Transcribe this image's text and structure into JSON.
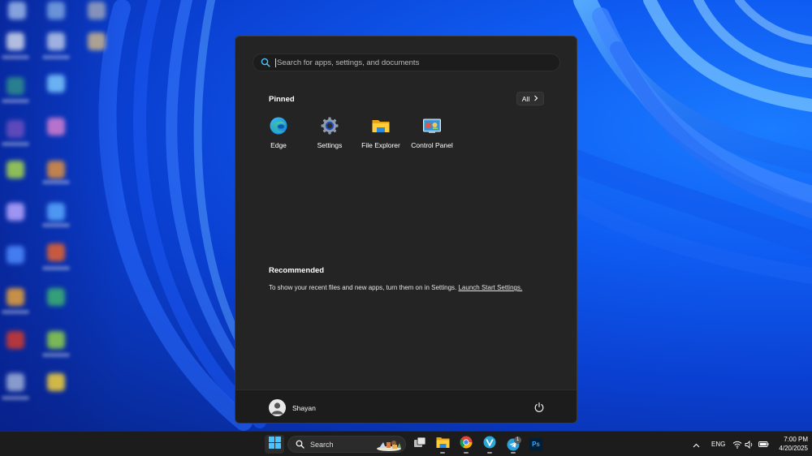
{
  "start_menu": {
    "search": {
      "placeholder": "Search for apps, settings, and documents"
    },
    "pinned": {
      "title": "Pinned",
      "all_button": "All",
      "apps": [
        {
          "label": "Edge",
          "icon": "edge-icon"
        },
        {
          "label": "Settings",
          "icon": "gear-icon"
        },
        {
          "label": "File Explorer",
          "icon": "folder-icon"
        },
        {
          "label": "Control Panel",
          "icon": "control-panel-icon"
        }
      ]
    },
    "recommended": {
      "title": "Recommended",
      "message": "To show your recent files and new apps, turn them on in Settings.",
      "link": "Launch Start Settings."
    },
    "user": {
      "name": "Shayan",
      "icon": "avatar-icon"
    },
    "power_icon": "power-icon"
  },
  "taskbar": {
    "search_label": "Search",
    "apps": [
      {
        "name": "start",
        "icon": "windows-logo-icon",
        "active": true
      },
      {
        "name": "task-view",
        "icon": "task-view-icon"
      },
      {
        "name": "file-explorer",
        "icon": "folder-icon",
        "running": true
      },
      {
        "name": "chrome",
        "icon": "chrome-icon",
        "running": true
      },
      {
        "name": "app-v",
        "icon": "v-circle-icon",
        "running": true
      },
      {
        "name": "telegram",
        "icon": "telegram-icon",
        "running": true,
        "badge": "1"
      },
      {
        "name": "photoshop",
        "icon": "photoshop-icon",
        "label": "Ps"
      }
    ],
    "tray": {
      "language": "ENG",
      "time": "7:00 PM",
      "date": "4/20/2025"
    }
  },
  "colors": {
    "menu_bg": "#242424",
    "taskbar_bg": "#1c1c1c",
    "wallpaper_blue": "#0a3fd8",
    "accent": "#4cc2ff"
  }
}
